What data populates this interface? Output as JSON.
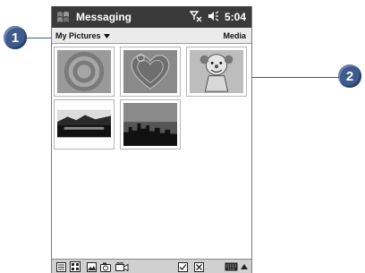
{
  "titlebar": {
    "app_title": "Messaging",
    "time": "5:04",
    "start_icon": "windows-flag-icon",
    "signal_icon": "no-signal-icon",
    "volume_icon": "speaker-icon"
  },
  "subbar": {
    "folder_label": "My Pictures",
    "media_label": "Media"
  },
  "callouts": {
    "one": "1",
    "two": "2"
  },
  "thumbnails": [
    {
      "name": "thumbnail-target"
    },
    {
      "name": "thumbnail-heart"
    },
    {
      "name": "thumbnail-clown"
    },
    {
      "name": "thumbnail-lake-sunset"
    },
    {
      "name": "thumbnail-city-silhouette"
    }
  ],
  "toolbar": {
    "buttons": [
      "list-view-icon",
      "thumbnail-view-icon",
      "picture-icon",
      "camera-icon",
      "video-camera-icon",
      "checkbox-icon",
      "delete-icon",
      "keyboard-icon",
      "sip-arrow-icon"
    ]
  },
  "colors": {
    "titlebar": "#3a3a3a",
    "subbar": "#ebebeb",
    "callout": "#3f5a8c"
  }
}
